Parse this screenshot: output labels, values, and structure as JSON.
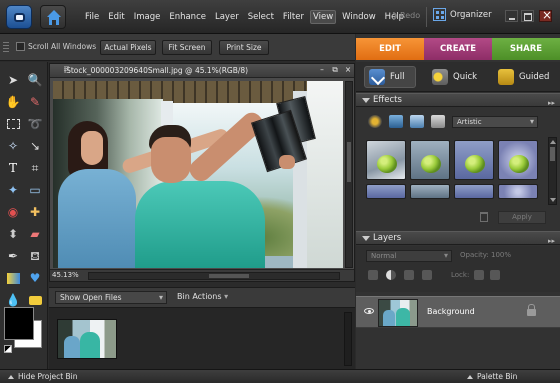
{
  "menubar": {
    "menus": [
      "File",
      "Edit",
      "Image",
      "Enhance",
      "Layer",
      "Select",
      "Filter",
      "View",
      "Window",
      "Help"
    ],
    "active_menu": "View",
    "redo_label": "Redo",
    "organizer_label": "Organizer"
  },
  "options_bar": {
    "scroll_all_label": "Scroll All Windows",
    "actual_pixels_label": "Actual Pixels",
    "fit_screen_label": "Fit Screen",
    "print_size_label": "Print Size"
  },
  "mode_tabs": {
    "edit": "EDIT",
    "create": "CREATE",
    "share": "SHARE"
  },
  "edit_modes": {
    "full": "Full",
    "quick": "Quick",
    "guided": "Guided"
  },
  "effects": {
    "title": "Effects",
    "category": "Artistic",
    "apply_label": "Apply"
  },
  "layers": {
    "title": "Layers",
    "blend_mode": "Normal",
    "opacity_label": "Opacity:",
    "opacity_value": "100%",
    "lock_label": "Lock:",
    "layer_name": "Background"
  },
  "document": {
    "title": "iStock_000003209640Small.jpg @ 45.1%(RGB/8)",
    "zoom": "45.13%"
  },
  "project_bin": {
    "show_label": "Show Open Files",
    "actions_label": "Bin Actions"
  },
  "bottom_bar": {
    "hide_bin_label": "Hide Project Bin",
    "palette_bin_label": "Palette Bin"
  },
  "colors": {
    "edit_tab": "#e8761d",
    "create_tab": "#9b3573",
    "share_tab": "#5a9b32",
    "foreground_swatch": "#000000",
    "background_swatch": "#ffffff"
  }
}
